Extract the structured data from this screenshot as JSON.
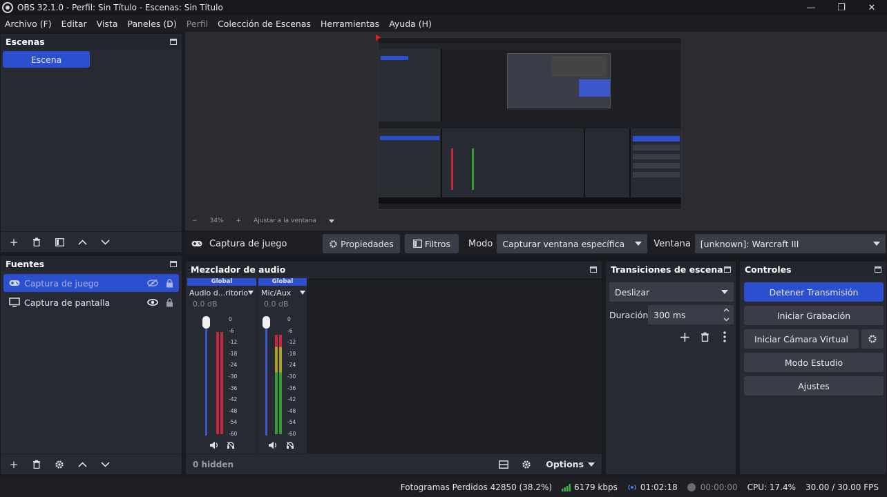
{
  "window": {
    "title": "OBS 32.1.0 - Perfil: Sin Título - Escenas: Sin Título"
  },
  "menu": [
    "Archivo (F)",
    "Editar",
    "Vista",
    "Paneles (D)",
    "Perfil",
    "Colección de Escenas",
    "Herramientas",
    "Ayuda (H)"
  ],
  "scenes": {
    "title": "Escenas",
    "items": [
      "Escena"
    ]
  },
  "sources": {
    "title": "Fuentes",
    "items": [
      "Captura de juego",
      "Captura de pantalla"
    ]
  },
  "preview": {
    "zoom": "34%",
    "fit_label": "Ajustar a la ventana"
  },
  "sourcebar": {
    "name": "Captura de juego",
    "props": "Propiedades",
    "filters": "Filtros",
    "mode_label": "Modo",
    "mode_value": "Capturar ventana específica",
    "window_label": "Ventana",
    "window_value": "[unknown]: Warcraft III"
  },
  "mixer": {
    "title": "Mezclador de audio",
    "channels": [
      {
        "tag": "Global",
        "name": "Audio d...ritorio",
        "db": "0.0 dB",
        "level": 0.88
      },
      {
        "tag": "Global",
        "name": "Mic/Aux",
        "db": "0.0 dB",
        "level": 0.86
      }
    ],
    "ticks": [
      "0",
      "-6",
      "-12",
      "-18",
      "-24",
      "-30",
      "-36",
      "-42",
      "-48",
      "-54",
      "-60"
    ],
    "hidden": "0 hidden",
    "options": "Options"
  },
  "transitions": {
    "title": "Transiciones de escena",
    "type": "Deslizar",
    "duration_label": "Duración",
    "duration_value": "300 ms"
  },
  "controls": {
    "title": "Controles",
    "stop_stream": "Detener Transmisión",
    "start_record": "Iniciar Grabación",
    "virtual_cam": "Iniciar Cámara Virtual",
    "studio": "Modo Estudio",
    "settings": "Ajustes"
  },
  "status": {
    "dropped": "Fotogramas Perdidos 42850 (38.2%)",
    "bitrate": "6179 kbps",
    "stream_time": "01:02:18",
    "rec_time": "00:00:00",
    "cpu": "CPU: 17.4%",
    "fps": "30.00 / 30.00 FPS"
  },
  "colors": {
    "accent": "#2c4fd0",
    "meter_red": "#c8283c",
    "meter_green": "#3a9a3a",
    "meter_yellow": "#a8a030"
  }
}
